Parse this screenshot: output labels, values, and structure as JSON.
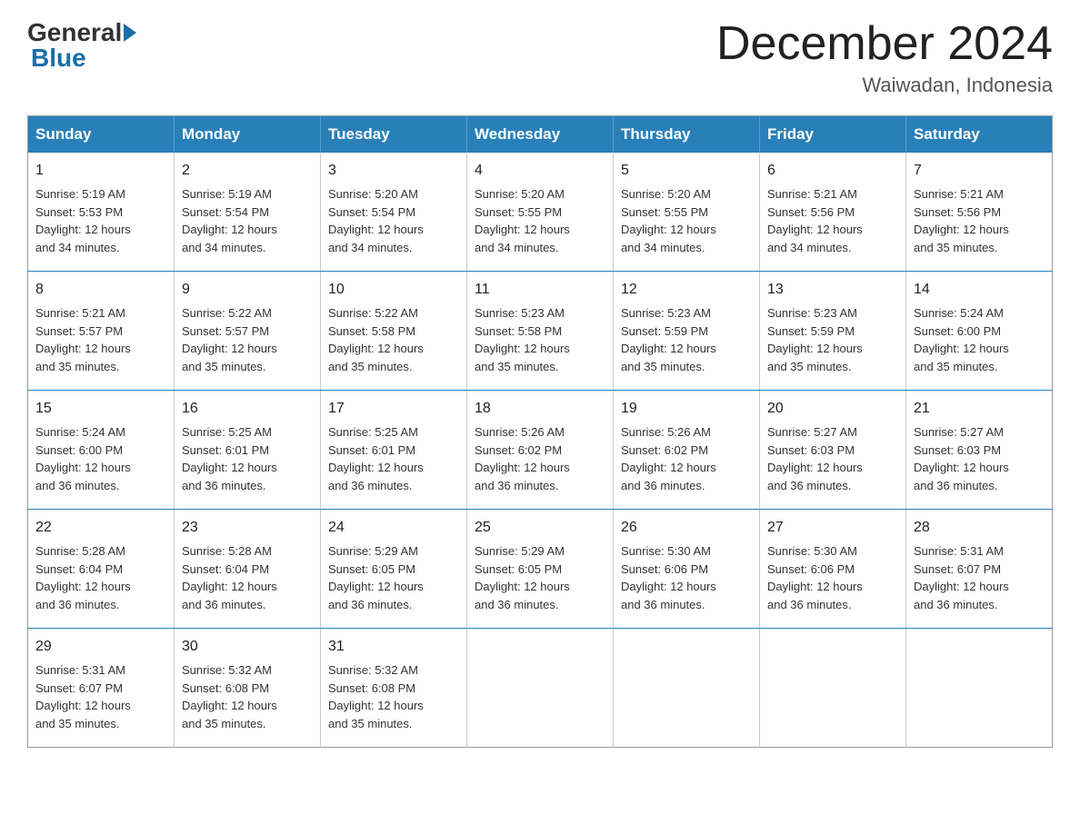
{
  "header": {
    "logo_general": "General",
    "logo_blue": "Blue",
    "month_title": "December 2024",
    "location": "Waiwadan, Indonesia"
  },
  "weekdays": [
    "Sunday",
    "Monday",
    "Tuesday",
    "Wednesday",
    "Thursday",
    "Friday",
    "Saturday"
  ],
  "weeks": [
    [
      {
        "day": "1",
        "info": "Sunrise: 5:19 AM\nSunset: 5:53 PM\nDaylight: 12 hours\nand 34 minutes."
      },
      {
        "day": "2",
        "info": "Sunrise: 5:19 AM\nSunset: 5:54 PM\nDaylight: 12 hours\nand 34 minutes."
      },
      {
        "day": "3",
        "info": "Sunrise: 5:20 AM\nSunset: 5:54 PM\nDaylight: 12 hours\nand 34 minutes."
      },
      {
        "day": "4",
        "info": "Sunrise: 5:20 AM\nSunset: 5:55 PM\nDaylight: 12 hours\nand 34 minutes."
      },
      {
        "day": "5",
        "info": "Sunrise: 5:20 AM\nSunset: 5:55 PM\nDaylight: 12 hours\nand 34 minutes."
      },
      {
        "day": "6",
        "info": "Sunrise: 5:21 AM\nSunset: 5:56 PM\nDaylight: 12 hours\nand 34 minutes."
      },
      {
        "day": "7",
        "info": "Sunrise: 5:21 AM\nSunset: 5:56 PM\nDaylight: 12 hours\nand 35 minutes."
      }
    ],
    [
      {
        "day": "8",
        "info": "Sunrise: 5:21 AM\nSunset: 5:57 PM\nDaylight: 12 hours\nand 35 minutes."
      },
      {
        "day": "9",
        "info": "Sunrise: 5:22 AM\nSunset: 5:57 PM\nDaylight: 12 hours\nand 35 minutes."
      },
      {
        "day": "10",
        "info": "Sunrise: 5:22 AM\nSunset: 5:58 PM\nDaylight: 12 hours\nand 35 minutes."
      },
      {
        "day": "11",
        "info": "Sunrise: 5:23 AM\nSunset: 5:58 PM\nDaylight: 12 hours\nand 35 minutes."
      },
      {
        "day": "12",
        "info": "Sunrise: 5:23 AM\nSunset: 5:59 PM\nDaylight: 12 hours\nand 35 minutes."
      },
      {
        "day": "13",
        "info": "Sunrise: 5:23 AM\nSunset: 5:59 PM\nDaylight: 12 hours\nand 35 minutes."
      },
      {
        "day": "14",
        "info": "Sunrise: 5:24 AM\nSunset: 6:00 PM\nDaylight: 12 hours\nand 35 minutes."
      }
    ],
    [
      {
        "day": "15",
        "info": "Sunrise: 5:24 AM\nSunset: 6:00 PM\nDaylight: 12 hours\nand 36 minutes."
      },
      {
        "day": "16",
        "info": "Sunrise: 5:25 AM\nSunset: 6:01 PM\nDaylight: 12 hours\nand 36 minutes."
      },
      {
        "day": "17",
        "info": "Sunrise: 5:25 AM\nSunset: 6:01 PM\nDaylight: 12 hours\nand 36 minutes."
      },
      {
        "day": "18",
        "info": "Sunrise: 5:26 AM\nSunset: 6:02 PM\nDaylight: 12 hours\nand 36 minutes."
      },
      {
        "day": "19",
        "info": "Sunrise: 5:26 AM\nSunset: 6:02 PM\nDaylight: 12 hours\nand 36 minutes."
      },
      {
        "day": "20",
        "info": "Sunrise: 5:27 AM\nSunset: 6:03 PM\nDaylight: 12 hours\nand 36 minutes."
      },
      {
        "day": "21",
        "info": "Sunrise: 5:27 AM\nSunset: 6:03 PM\nDaylight: 12 hours\nand 36 minutes."
      }
    ],
    [
      {
        "day": "22",
        "info": "Sunrise: 5:28 AM\nSunset: 6:04 PM\nDaylight: 12 hours\nand 36 minutes."
      },
      {
        "day": "23",
        "info": "Sunrise: 5:28 AM\nSunset: 6:04 PM\nDaylight: 12 hours\nand 36 minutes."
      },
      {
        "day": "24",
        "info": "Sunrise: 5:29 AM\nSunset: 6:05 PM\nDaylight: 12 hours\nand 36 minutes."
      },
      {
        "day": "25",
        "info": "Sunrise: 5:29 AM\nSunset: 6:05 PM\nDaylight: 12 hours\nand 36 minutes."
      },
      {
        "day": "26",
        "info": "Sunrise: 5:30 AM\nSunset: 6:06 PM\nDaylight: 12 hours\nand 36 minutes."
      },
      {
        "day": "27",
        "info": "Sunrise: 5:30 AM\nSunset: 6:06 PM\nDaylight: 12 hours\nand 36 minutes."
      },
      {
        "day": "28",
        "info": "Sunrise: 5:31 AM\nSunset: 6:07 PM\nDaylight: 12 hours\nand 36 minutes."
      }
    ],
    [
      {
        "day": "29",
        "info": "Sunrise: 5:31 AM\nSunset: 6:07 PM\nDaylight: 12 hours\nand 35 minutes."
      },
      {
        "day": "30",
        "info": "Sunrise: 5:32 AM\nSunset: 6:08 PM\nDaylight: 12 hours\nand 35 minutes."
      },
      {
        "day": "31",
        "info": "Sunrise: 5:32 AM\nSunset: 6:08 PM\nDaylight: 12 hours\nand 35 minutes."
      },
      {
        "day": "",
        "info": ""
      },
      {
        "day": "",
        "info": ""
      },
      {
        "day": "",
        "info": ""
      },
      {
        "day": "",
        "info": ""
      }
    ]
  ]
}
